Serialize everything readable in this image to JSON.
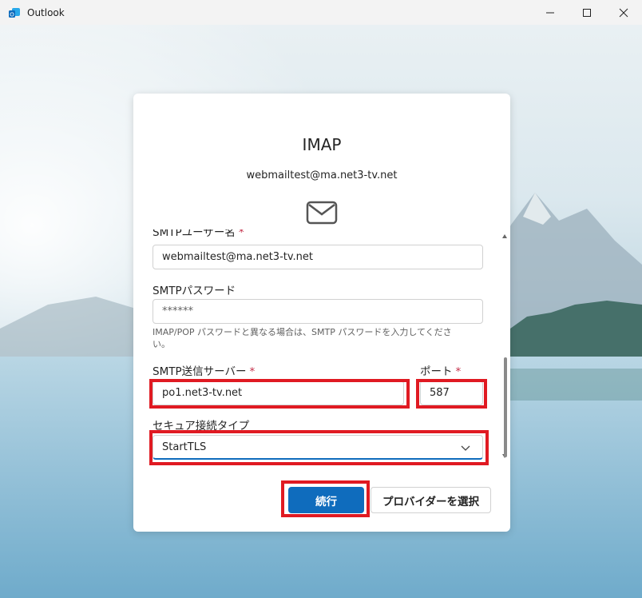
{
  "window": {
    "title": "Outlook",
    "minimize": "—",
    "maximize": "☐",
    "close": "✕"
  },
  "dialog": {
    "title": "IMAP",
    "email": "webmailtest@ma.net3-tv.net",
    "smtp_user_label": "SMTPユーザー名",
    "smtp_user_value": "webmailtest@ma.net3-tv.net",
    "smtp_password_label": "SMTPパスワード",
    "smtp_password_value": "******",
    "help_text": "IMAP/POP パスワードと異なる場合は、SMTP パスワードを入力してください。",
    "smtp_server_label": "SMTP送信サーバー",
    "smtp_server_value": "po1.net3-tv.net",
    "port_label": "ポート",
    "port_value": "587",
    "secure_label": "セキュア接続タイプ",
    "secure_value": "StartTLS",
    "required_mark": "*",
    "continue_button": "続行",
    "provider_button": "プロバイダーを選択"
  },
  "colors": {
    "accent": "#0f6cbd",
    "highlight": "#e01a22",
    "required": "#c4314b"
  }
}
